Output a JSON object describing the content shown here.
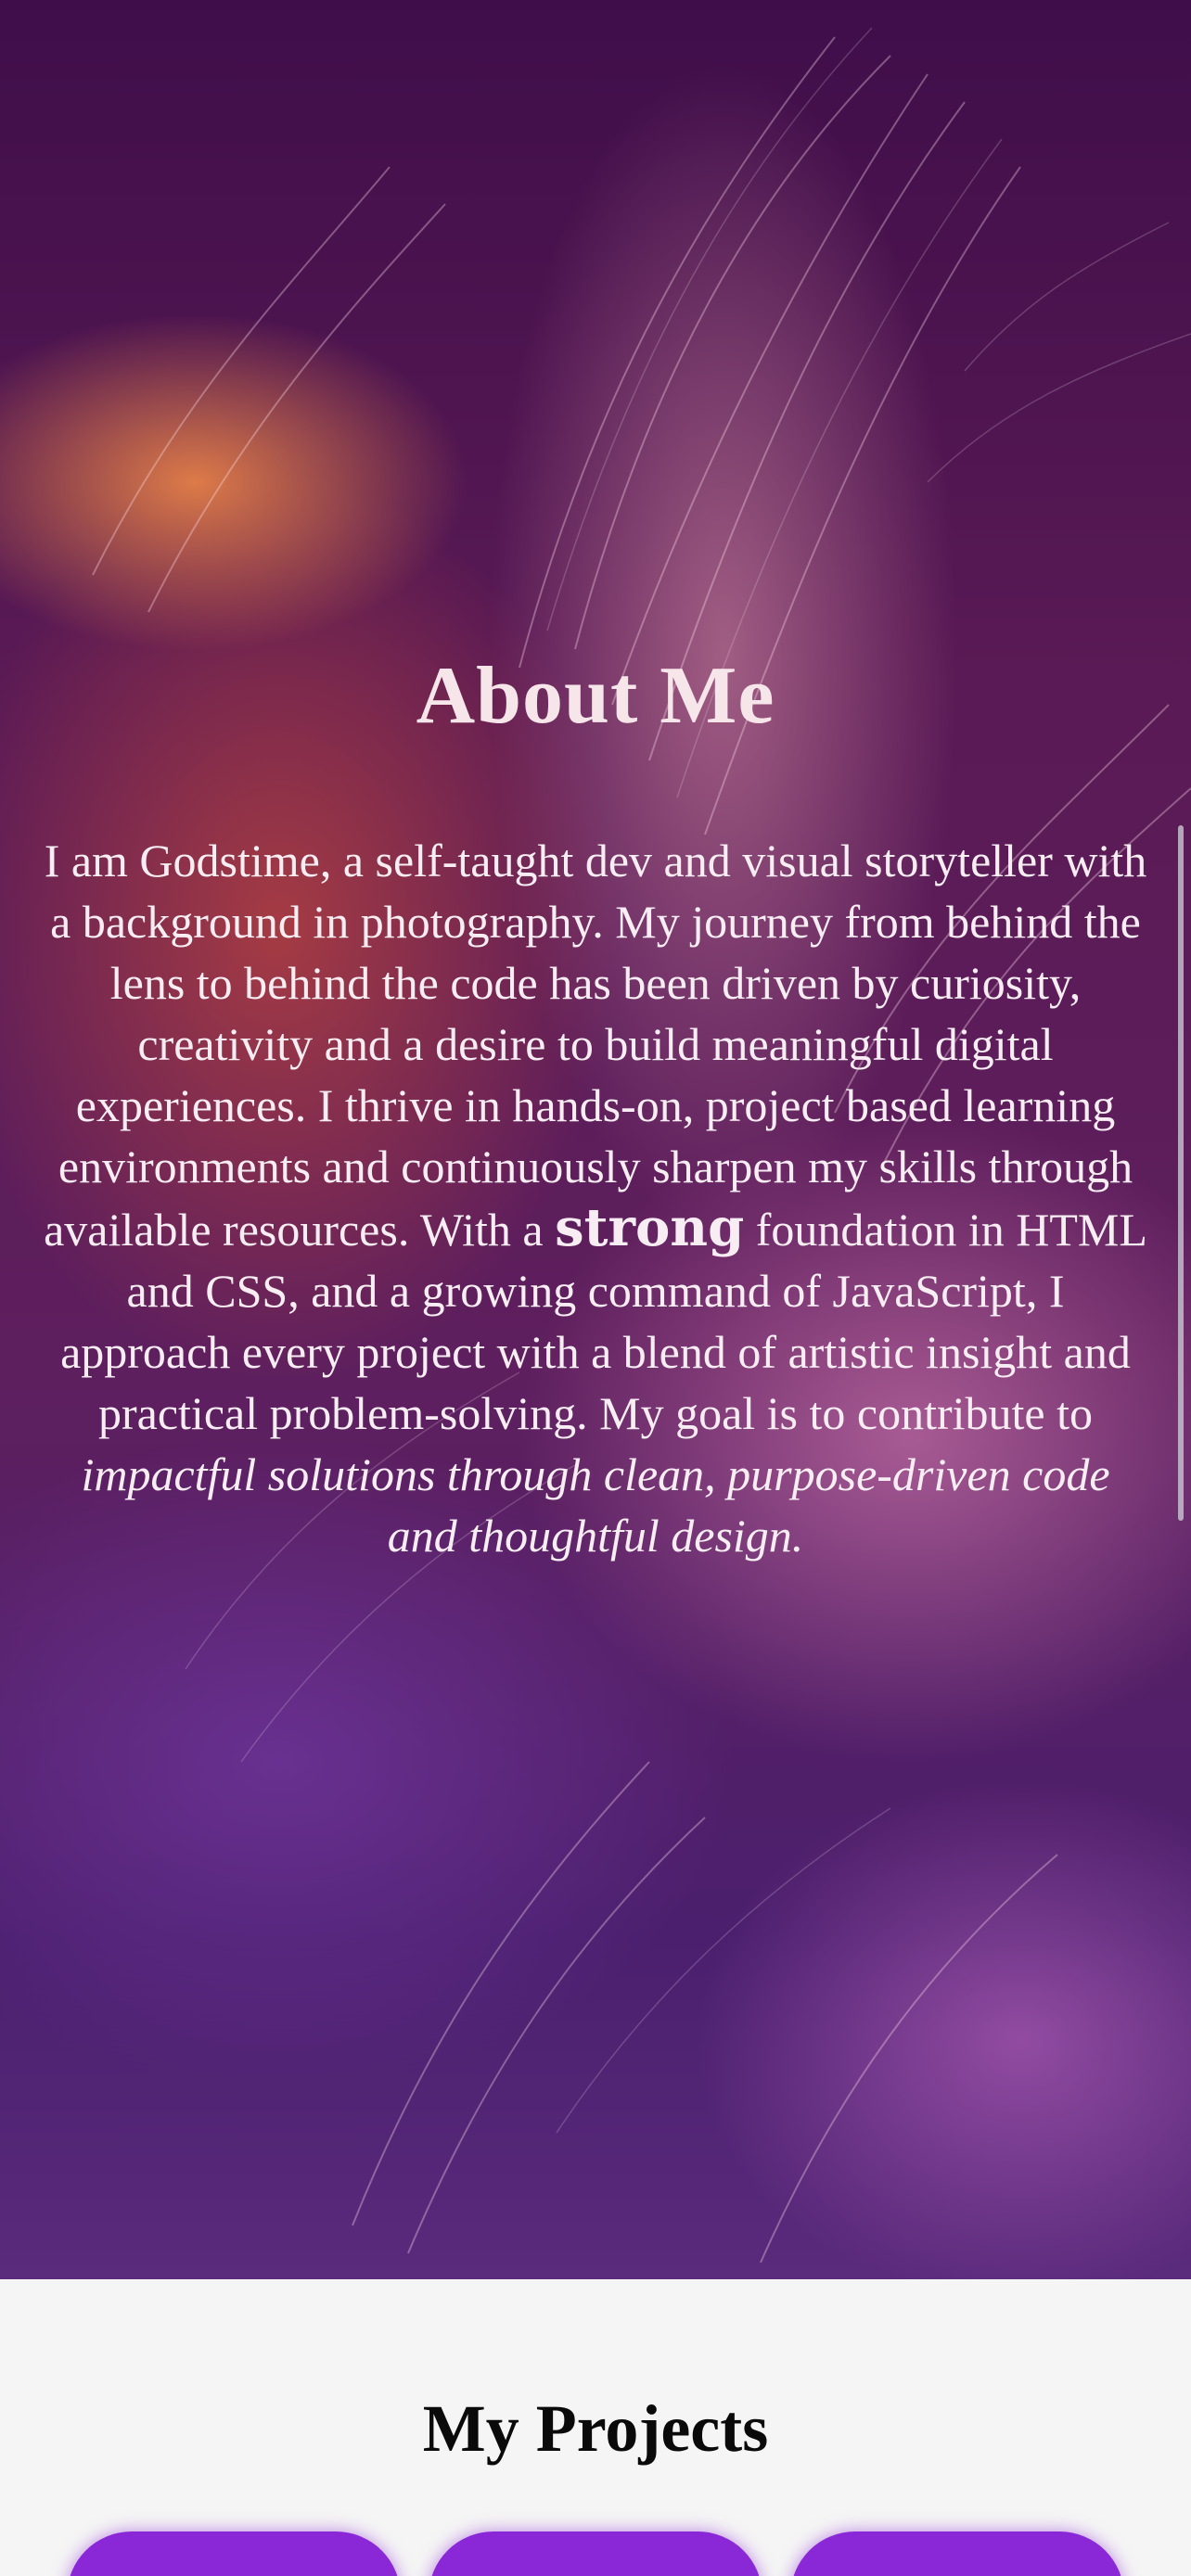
{
  "about": {
    "title": "About Me",
    "part1": "I am Godstime, a self-taught dev and visual storyteller with a background in photography. My journey from behind the lens to behind the code has been driven by curiosity, creativity and a desire to build meaningful digital experiences. I thrive in hands-on, project based learning environments and continuously sharpen my skills through available resources. With a ",
    "strong": "strong",
    "part2": " foundation in HTML and CSS, and a growing command of JavaScript, I approach every project with a blend of artistic insight and practical problem-solving. My goal is to contribute to ",
    "italic": "impactful solutions through clean, purpose-driven code and thoughtful design."
  },
  "projects": {
    "title": "My Projects"
  },
  "colors": {
    "accent": "#8a27d6",
    "hero_dark": "#4b1f6e"
  }
}
